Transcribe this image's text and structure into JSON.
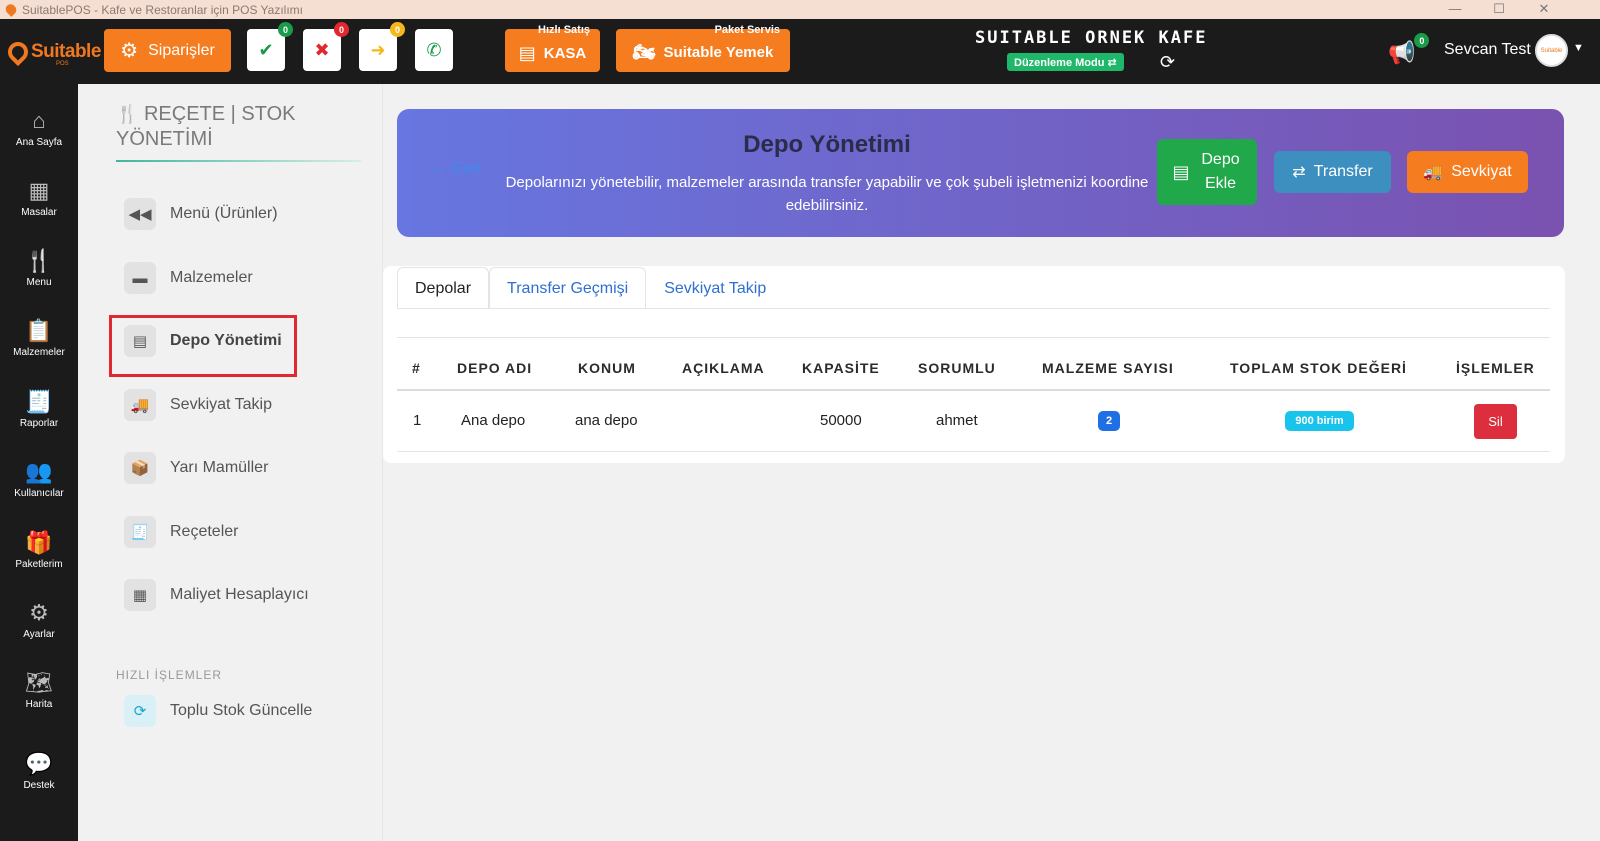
{
  "window": {
    "title": "SuitablePOS - Kafe ve Restoranlar için POS Yazılımı",
    "minimize": "—",
    "maximize": "☐",
    "close": "✕"
  },
  "topbar": {
    "logo_text": "Suitable",
    "logo_sub": "POS",
    "orders_label": "Siparişler",
    "status_buttons": [
      {
        "icon": "check-icon",
        "glyph": "✔",
        "badge": "0",
        "color": "#1a9b4a"
      },
      {
        "icon": "x-icon",
        "glyph": "✖",
        "badge": "0",
        "color": "#e0282e"
      },
      {
        "icon": "arrow-right-icon",
        "glyph": "➜",
        "badge": "0",
        "color": "#f4b81a"
      },
      {
        "icon": "phone-icon",
        "glyph": "✆",
        "badge": "",
        "color": "#1a9b4a"
      }
    ],
    "quick_sale_label": "Hızlı Satış",
    "kasa_label": "KASA",
    "package_label": "Paket Servis",
    "suitable_yemek_label": "Suitable Yemek",
    "cafe_name": "SUITABLE ORNEK KAFE",
    "edit_mode_label": "Düzenleme Modu ⇄",
    "notifications_badge": "0",
    "user_name": "Sevcan Test",
    "avatar_text": "Suitable"
  },
  "sidebar": {
    "items": [
      {
        "label": "Ana Sayfa",
        "icon": "home-icon",
        "glyph": "⌂"
      },
      {
        "label": "Masalar",
        "icon": "tables-icon",
        "glyph": "▦"
      },
      {
        "label": "Menu",
        "icon": "utensils-icon",
        "glyph": "🍴"
      },
      {
        "label": "Malzemeler",
        "icon": "clipboard-icon",
        "glyph": "📋"
      },
      {
        "label": "Raporlar",
        "icon": "receipt-icon",
        "glyph": "🧾"
      },
      {
        "label": "Kullanıcılar",
        "icon": "users-icon",
        "glyph": "👥"
      },
      {
        "label": "Paketlerim",
        "icon": "gift-icon",
        "glyph": "🎁"
      },
      {
        "label": "Ayarlar",
        "icon": "cogs-icon",
        "glyph": "⚙"
      },
      {
        "label": "Harita",
        "icon": "map-icon",
        "glyph": "🗺"
      },
      {
        "label": "Destek",
        "icon": "comments-icon",
        "glyph": "💬"
      }
    ]
  },
  "left_panel": {
    "title": "REÇETE | STOK YÖNETİMİ",
    "items": [
      {
        "label": "Menü (Ürünler)",
        "icon": "backward-icon",
        "glyph": "◀◀"
      },
      {
        "label": "Malzemeler",
        "icon": "box-icon",
        "glyph": "▬"
      },
      {
        "label": "Depo Yönetimi",
        "icon": "warehouse-icon",
        "glyph": "▤"
      },
      {
        "label": "Sevkiyat Takip",
        "icon": "truck-icon",
        "glyph": "🚚"
      },
      {
        "label": "Yarı Mamüller",
        "icon": "box-open-icon",
        "glyph": "📦"
      },
      {
        "label": "Reçeteler",
        "icon": "receipt-icon",
        "glyph": "🧾"
      },
      {
        "label": "Maliyet Hesaplayıcı",
        "icon": "calculator-icon",
        "glyph": "▦"
      }
    ],
    "quick_section": "HIZLI İŞLEMLER",
    "quick_item": {
      "label": "Toplu Stok Güncelle",
      "icon": "sync-icon",
      "glyph": "⟳"
    }
  },
  "hero": {
    "back_label": "← Geri",
    "title": "Depo Yönetimi",
    "description": "Depolarınızı yönetebilir, malzemeler arasında transfer yapabilir ve çok şubeli işletmenizi koordine edebilirsiniz.",
    "add_label": "Depo Ekle",
    "transfer_label": "Transfer",
    "shipment_label": "Sevkiyat",
    "colors": {
      "add": "#21a84a",
      "transfer": "#3d8fc0",
      "shipment": "#f57c1f"
    }
  },
  "tabs": [
    "Depolar",
    "Transfer Geçmişi",
    "Sevkiyat Takip"
  ],
  "table": {
    "headers": [
      "#",
      "DEPO ADI",
      "KONUM",
      "AÇIKLAMA",
      "KAPASİTE",
      "SORUMLU",
      "MALZEME SAYISI",
      "TOPLAM STOK DEĞERİ",
      "İŞLEMLER"
    ],
    "rows": [
      {
        "index": "1",
        "name": "Ana depo",
        "location": "ana depo",
        "description": "",
        "capacity": "50000",
        "responsible": "ahmet",
        "material_count": "2",
        "stock_value": "900 birim",
        "action": "Sil"
      }
    ]
  }
}
